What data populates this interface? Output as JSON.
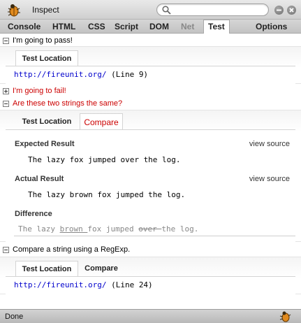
{
  "toolbar": {
    "title": "Inspect",
    "search_placeholder": ""
  },
  "tabs": [
    "Console",
    "HTML",
    "CSS",
    "Script",
    "DOM",
    "Net",
    "Test",
    "Options"
  ],
  "tests": [
    {
      "label": "I'm going to pass!",
      "status": "pass",
      "expanded": true,
      "panel_tabs": [
        "Test Location"
      ],
      "location_link": "http://fireunit.org/",
      "location_line": "(Line 9)"
    },
    {
      "label": "I'm going to fail!",
      "status": "fail",
      "expanded": false
    },
    {
      "label": "Are these two strings the same?",
      "status": "fail",
      "expanded": true,
      "panel_tabs": [
        "Test Location",
        "Compare"
      ],
      "expected_title": "Expected Result",
      "expected_value": "The lazy fox jumped over the log.",
      "actual_title": "Actual Result",
      "actual_value": "The lazy brown fox jumped the log.",
      "view_source": "view source",
      "difference_title": "Difference",
      "difference": {
        "a": "The lazy ",
        "ins": "brown ",
        "b": "fox jumped ",
        "del": "over ",
        "c": "the log."
      }
    },
    {
      "label": "Compare a string using a RegExp.",
      "status": "pass",
      "expanded": true,
      "panel_tabs": [
        "Test Location",
        "Compare"
      ],
      "location_link": "http://fireunit.org/",
      "location_line": "(Line 24)"
    }
  ],
  "status_bar": {
    "text": "Done"
  },
  "colors": {
    "fail": "#cc0000",
    "link": "#0000cc"
  }
}
